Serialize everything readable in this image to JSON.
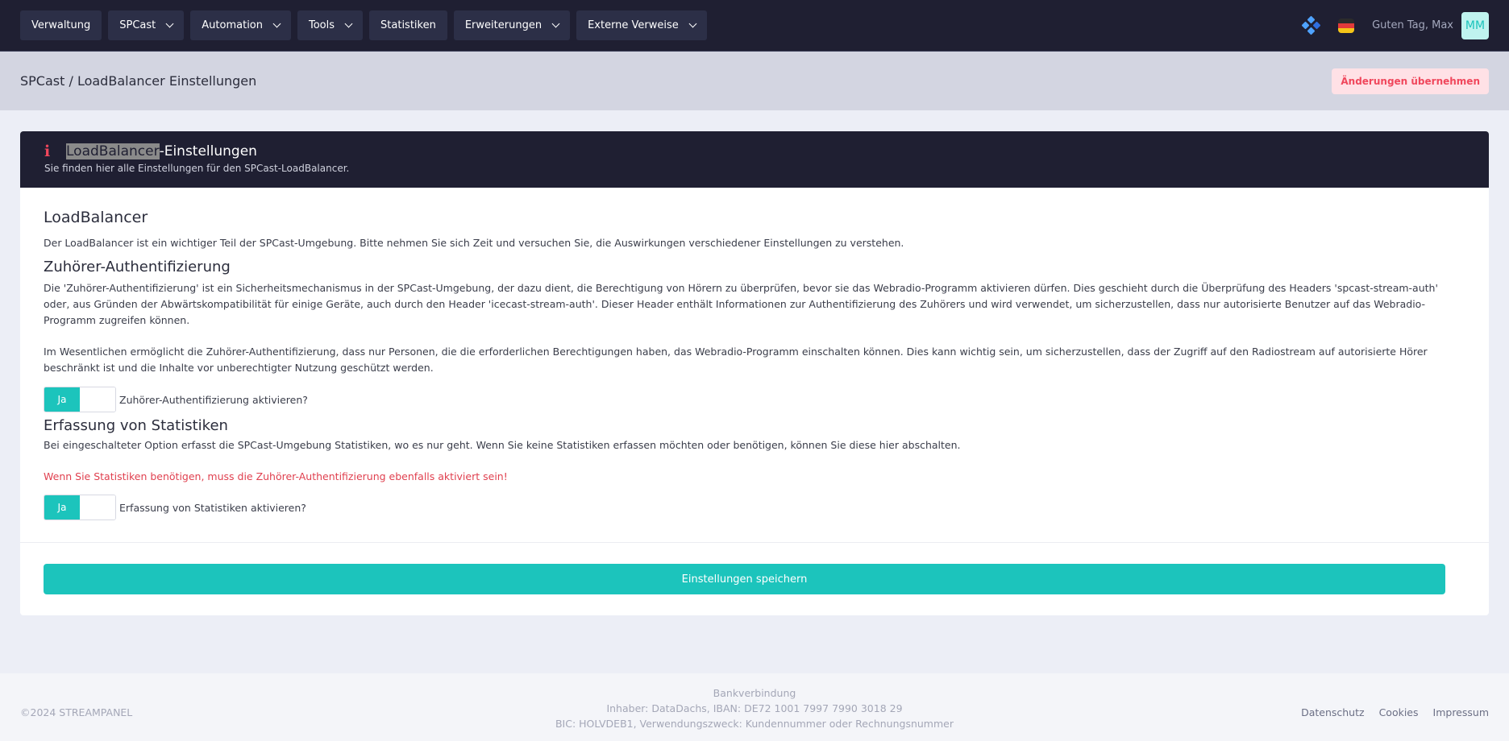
{
  "nav": {
    "items": [
      {
        "label": "Verwaltung"
      },
      {
        "label": "SPCast"
      },
      {
        "label": "Automation"
      },
      {
        "label": "Tools"
      },
      {
        "label": "Statistiken"
      },
      {
        "label": "Erweiterungen"
      },
      {
        "label": "Externe Verweise"
      }
    ],
    "greeting": "Guten Tag, Max",
    "avatar_initials": "MM"
  },
  "subheader": {
    "breadcrumb": "SPCast / LoadBalancer Einstellungen",
    "apply_label": "Änderungen übernehmen"
  },
  "card": {
    "title_highlight": "LoadBalancer",
    "title_rest": "-Einstellungen",
    "subtitle": "Sie finden hier alle Einstellungen für den SPCast-LoadBalancer."
  },
  "sections": {
    "loadbalancer": {
      "heading": "LoadBalancer",
      "text": "Der LoadBalancer ist ein wichtiger Teil der SPCast-Umgebung. Bitte nehmen Sie sich Zeit und versuchen Sie, die Auswirkungen verschiedener Einstellungen zu verstehen."
    },
    "auth": {
      "heading": "Zuhörer-Authentifizierung",
      "text1": "Die 'Zuhörer-Authentifizierung' ist ein Sicherheitsmechanismus in der SPCast-Umgebung, der dazu dient, die Berechtigung von Hörern zu überprüfen, bevor sie das Webradio-Programm aktivieren dürfen. Dies geschieht durch die Überprüfung des Headers 'spcast-stream-auth' oder, aus Gründen der Abwärtskompatibilität für einige Geräte, auch durch den Header 'icecast-stream-auth'. Dieser Header enthält Informationen zur Authentifizierung des Zuhörers und wird verwendet, um sicherzustellen, dass nur autorisierte Benutzer auf das Webradio-Programm zugreifen können.",
      "text2": "Im Wesentlichen ermöglicht die Zuhörer-Authentifizierung, dass nur Personen, die die erforderlichen Berechtigungen haben, das Webradio-Programm einschalten können. Dies kann wichtig sein, um sicherzustellen, dass der Zugriff auf den Radiostream auf autorisierte Hörer beschränkt ist und die Inhalte vor unberechtigter Nutzung geschützt werden.",
      "toggle_on": "Ja",
      "toggle_label": "Zuhörer-Authentifizierung aktivieren?"
    },
    "stats": {
      "heading": "Erfassung von Statistiken",
      "text": "Bei eingeschalteter Option erfasst die SPCast-Umgebung Statistiken, wo es nur geht. Wenn Sie keine Statistiken erfassen möchten oder benötigen, können Sie diese hier abschalten.",
      "warning": "Wenn Sie Statistiken benötigen, muss die Zuhörer-Authentifizierung ebenfalls aktiviert sein!",
      "toggle_on": "Ja",
      "toggle_label": "Erfassung von Statistiken aktivieren?"
    }
  },
  "save_label": "Einstellungen speichern",
  "footer": {
    "copyright": "©2024 STREAMPANEL",
    "bank_title": "Bankverbindung",
    "bank_line1": "Inhaber: DataDachs, IBAN: DE72 1001 7997 7990 3018 29",
    "bank_line2": "BIC: HOLVDEB1, Verwendungszweck: Kundennummer oder Rechnungsnummer",
    "links": [
      "Datenschutz",
      "Cookies",
      "Impressum"
    ]
  },
  "colors": {
    "accent": "#1cc4bc",
    "danger": "#f0475c",
    "nav_bg": "#1f1f32"
  },
  "icons": {
    "info": "info-icon",
    "chevron": "chevron-down-icon",
    "diamond": "diamond-logo-icon",
    "flag": "german-flag-icon"
  }
}
